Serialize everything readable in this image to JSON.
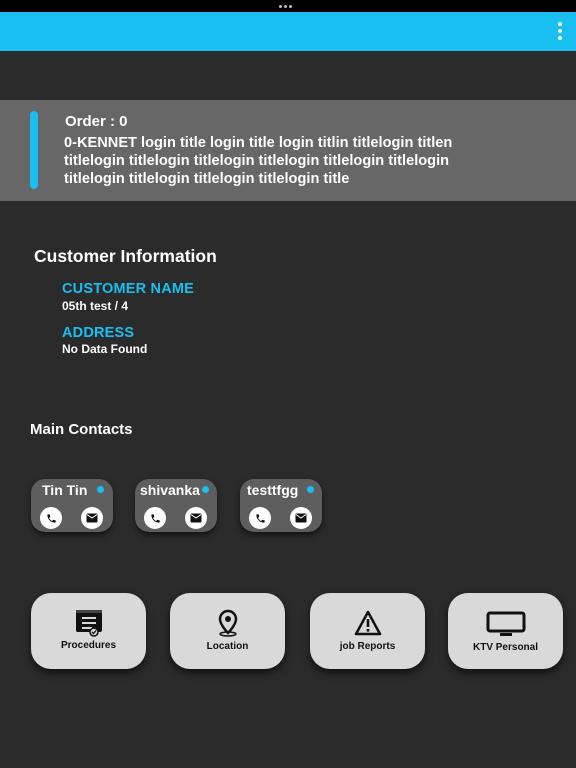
{
  "order": {
    "number": "Order : 0",
    "title": "0-KENNET login title login title login titlin titlelogin titlen titlelogin titlelogin titlelogin titlelogin titlelogin titlelogin titlelogin titlelogin titlelogin titlelogin title"
  },
  "customer": {
    "section_title": "Customer Information",
    "name_label": "CUSTOMER NAME",
    "name_value": "05th test / 4",
    "address_label": "ADDRESS",
    "address_value": "No Data Found"
  },
  "contacts": {
    "section_title": "Main Contacts",
    "items": [
      {
        "name": "Tin Tin"
      },
      {
        "name": "shivanka"
      },
      {
        "name": "testtfgg"
      }
    ]
  },
  "actions": [
    {
      "label": "Procedures",
      "icon": "procedures-icon"
    },
    {
      "label": "Location",
      "icon": "location-pin-icon"
    },
    {
      "label": "job Reports",
      "icon": "warning-icon"
    },
    {
      "label": "KTV Personal",
      "icon": "monitor-icon"
    }
  ],
  "colors": {
    "accent": "#19bff0",
    "background": "#2b2b2b",
    "card": "#676767",
    "button": "#d9d9d9"
  }
}
